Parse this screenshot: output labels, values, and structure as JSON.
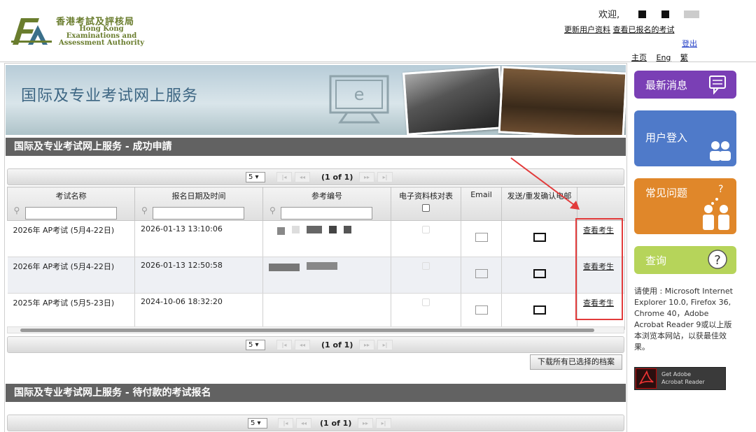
{
  "header": {
    "logo_cn": "香港考試及評核局",
    "logo_en_lines": [
      "Hong Kong",
      "Examinations and",
      "Assessment Authority"
    ],
    "welcome": "欢迎,",
    "link_update_profile": "更新用户资料",
    "link_view_exams": "查看已报名的考试",
    "logout": "登出",
    "lang": [
      "主页",
      "Eng",
      "繁"
    ]
  },
  "banner": {
    "title": "国际及专业考试网上服务"
  },
  "section_success": {
    "title": "国际及专业考试网上服务 - 成功申請"
  },
  "pager": {
    "page_size": "5",
    "info": "(1 of 1)"
  },
  "table": {
    "columns": [
      "考试名称",
      "报名日期及时间",
      "参考编号",
      "电子资料核对表",
      "Email",
      "发送/重发确认电邮"
    ],
    "rows": [
      {
        "exam": "2026年 AP考试 (5月4-22日)",
        "datetime": "2026-01-13 13:10:06",
        "action": "查看考生"
      },
      {
        "exam": "2026年 AP考试 (5月4-22日)",
        "datetime": "2026-01-13 12:50:58",
        "action": "查看考生"
      },
      {
        "exam": "2025年 AP考试 (5月5-23日)",
        "datetime": "2024-10-06 18:32:20",
        "action": "查看考生"
      }
    ]
  },
  "download_button": "下载所有已选择的档案",
  "section_pending": {
    "title": "国际及专业考试网上服务 - 待付款的考试报名"
  },
  "sidebar": {
    "news": "最新消息",
    "login": "用户登入",
    "faq": "常见问题",
    "query": "查询",
    "note": "请使用 : Microsoft Internet Explorer 10.0, Firefox 36, Chrome 40，Adobe Acrobat Reader 9或以上版本浏览本网站，以获最佳效果。",
    "adobe_line1": "Get Adobe",
    "adobe_line2": "Acrobat Reader"
  },
  "colors": {
    "section_bar": "#626262",
    "highlight": "#e23b3b",
    "news": "#7a3fb5",
    "login": "#4f7ac9",
    "faq": "#e0872a",
    "query": "#b6d45a"
  }
}
